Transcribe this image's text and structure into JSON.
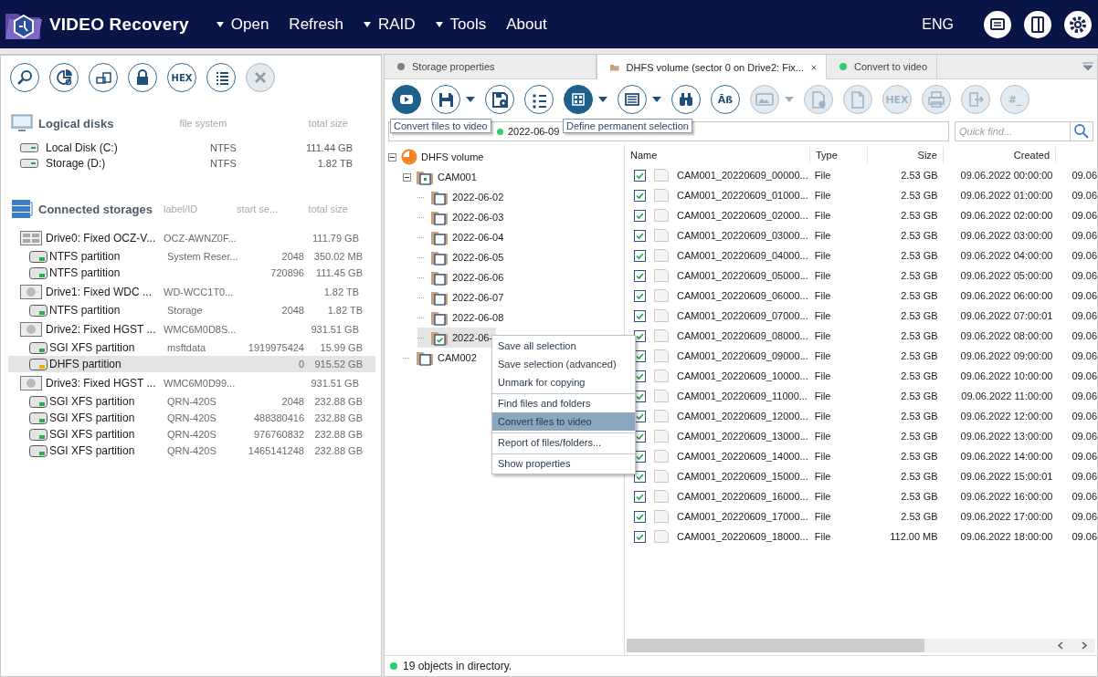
{
  "app": {
    "title": "VIDEO Recovery",
    "menu": [
      {
        "label": "Open",
        "dropdown": true
      },
      {
        "label": "Refresh",
        "dropdown": false
      },
      {
        "label": "RAID",
        "dropdown": true
      },
      {
        "label": "Tools",
        "dropdown": true
      },
      {
        "label": "About",
        "dropdown": false
      }
    ],
    "language": "ENG"
  },
  "left_toolbar": [
    {
      "disabled": false
    },
    {
      "disabled": false
    },
    {
      "disabled": false
    },
    {
      "disabled": false
    },
    {
      "label": "HEX",
      "disabled": false
    },
    {
      "disabled": false
    },
    {
      "disabled": true
    }
  ],
  "logical_disks": {
    "title": "Logical disks",
    "columns": [
      "file system",
      "total size"
    ],
    "rows": [
      {
        "name": "Local Disk (C:)",
        "file_system": "NTFS",
        "total_size": "111.44 GB"
      },
      {
        "name": "Storage (D:)",
        "file_system": "NTFS",
        "total_size": "1.82 TB"
      }
    ]
  },
  "connected_storages": {
    "title": "Connected storages",
    "columns": [
      "label/ID",
      "start se...",
      "total size"
    ],
    "drives": [
      {
        "kind": "ssd",
        "name": "Drive0: Fixed OCZ-V...",
        "label": "OCZ-AWNZ0F...",
        "total_size": "111.79 GB",
        "partitions": [
          {
            "name": "NTFS partition",
            "label": "System Reser...",
            "start": "2048",
            "total_size": "350.02 MB",
            "color": "#22b14c",
            "selected": false
          },
          {
            "name": "NTFS partition",
            "start": "720896",
            "total_size": "111.45 GB",
            "color": "#22b14c",
            "selected": false
          }
        ]
      },
      {
        "kind": "hdd",
        "name": "Drive1: Fixed WDC ...",
        "label": "WD-WCC1T0...",
        "total_size": "1.82 TB",
        "partitions": [
          {
            "name": "NTFS partition",
            "label": "Storage",
            "start": "2048",
            "total_size": "1.82 TB",
            "color": "#22b14c",
            "selected": false
          }
        ]
      },
      {
        "kind": "hdd",
        "name": "Drive2: Fixed HGST ...",
        "label": "WMC6M0D8S...",
        "total_size": "931.51 GB",
        "partitions": [
          {
            "name": "SGI XFS partition",
            "label": "msftdata",
            "start": "1919975424",
            "total_size": "15.99 GB",
            "color": "#22b14c",
            "selected": false
          },
          {
            "name": "DHFS partition",
            "start": "0",
            "total_size": "915.52 GB",
            "color": "#e8b400",
            "selected": true
          }
        ]
      },
      {
        "kind": "hdd",
        "name": "Drive3: Fixed HGST ...",
        "label": "WMC6M0D99...",
        "total_size": "931.51 GB",
        "partitions": [
          {
            "name": "SGI XFS partition",
            "label": "QRN-420S",
            "start": "2048",
            "total_size": "232.88 GB",
            "color": "#22b14c",
            "selected": false
          },
          {
            "name": "SGI XFS partition",
            "label": "QRN-420S",
            "start": "488380416",
            "total_size": "232.88 GB",
            "color": "#22b14c",
            "selected": false
          },
          {
            "name": "SGI XFS partition",
            "label": "QRN-420S",
            "start": "976760832",
            "total_size": "232.88 GB",
            "color": "#22b14c",
            "selected": false
          },
          {
            "name": "SGI XFS partition",
            "label": "QRN-420S",
            "start": "1465141248",
            "total_size": "232.88 GB",
            "color": "#22b14c",
            "selected": false
          }
        ]
      }
    ]
  },
  "tabs": [
    {
      "kind": "dot",
      "label": "Storage properties",
      "color": "#808080",
      "selected": false,
      "closable": false
    },
    {
      "kind": "folder",
      "label": "DHFS volume (sector 0 on Drive2: Fix...",
      "selected": true,
      "closable": true
    },
    {
      "kind": "dot",
      "label": "Convert to video",
      "color": "#2ecc71",
      "selected": false,
      "closable": false
    }
  ],
  "toolbar": [
    {
      "active": true,
      "dropdown": false,
      "disabled": false,
      "tooltip": "Convert files to video"
    },
    {
      "active": false,
      "dropdown": true,
      "disabled": false
    },
    {
      "active": false,
      "dropdown": false,
      "disabled": false
    },
    {
      "active": false,
      "dropdown": false,
      "disabled": false
    },
    {
      "active": true,
      "dropdown": true,
      "disabled": false,
      "tooltip": "Define permanent selection"
    },
    {
      "active": false,
      "dropdown": true,
      "disabled": false
    },
    {
      "active": false,
      "dropdown": false,
      "disabled": false
    },
    {
      "active": false,
      "dropdown": false,
      "disabled": false,
      "label": "Āß"
    },
    {
      "active": false,
      "dropdown": true,
      "disabled": true
    },
    {
      "active": false,
      "dropdown": false,
      "disabled": true
    },
    {
      "active": false,
      "dropdown": false,
      "disabled": true
    },
    {
      "active": false,
      "dropdown": false,
      "disabled": true,
      "label": "HEX"
    },
    {
      "active": false,
      "dropdown": false,
      "disabled": true
    },
    {
      "active": false,
      "dropdown": false,
      "disabled": true
    },
    {
      "active": false,
      "dropdown": false,
      "disabled": true,
      "label": "#_"
    }
  ],
  "breadcrumb": {
    "label": "2022-06-09",
    "color": "#2ecc71"
  },
  "quick_find": {
    "placeholder": "Quick find..."
  },
  "tree": {
    "label": "DHFS volume",
    "expanded": true,
    "selected": false,
    "children": [
      {
        "label": "CAM001",
        "expanded": true,
        "checked": false,
        "mixed": true,
        "selected": false,
        "children": [
          {
            "label": "2022-06-02",
            "checked": false,
            "mixed": false,
            "selected": false
          },
          {
            "label": "2022-06-03",
            "checked": false,
            "mixed": false,
            "selected": false
          },
          {
            "label": "2022-06-04",
            "checked": false,
            "mixed": false,
            "selected": false
          },
          {
            "label": "2022-06-05",
            "checked": false,
            "mixed": false,
            "selected": false
          },
          {
            "label": "2022-06-06",
            "checked": false,
            "mixed": false,
            "selected": false
          },
          {
            "label": "2022-06-07",
            "checked": false,
            "mixed": false,
            "selected": false
          },
          {
            "label": "2022-06-08",
            "checked": false,
            "mixed": false,
            "selected": false
          },
          {
            "label": "2022-06-",
            "checked": true,
            "mixed": false,
            "selected": true
          }
        ]
      },
      {
        "label": "CAM002",
        "checked": false,
        "mixed": false,
        "selected": false
      }
    ]
  },
  "table": {
    "columns": [
      "Name",
      "Type",
      "Size",
      "Created"
    ],
    "rows": [
      {
        "checked": true,
        "name": "CAM001_20220609_00000...",
        "type": "File",
        "size": "2.53 GB",
        "created": "09.06.2022 00:00:00",
        "column_5": "09.06"
      },
      {
        "checked": true,
        "name": "CAM001_20220609_01000...",
        "type": "File",
        "size": "2.53 GB",
        "created": "09.06.2022 01:00:00",
        "column_5": "09.06"
      },
      {
        "checked": true,
        "name": "CAM001_20220609_02000...",
        "type": "File",
        "size": "2.53 GB",
        "created": "09.06.2022 02:00:00",
        "column_5": "09.06"
      },
      {
        "checked": true,
        "name": "CAM001_20220609_03000...",
        "type": "File",
        "size": "2.53 GB",
        "created": "09.06.2022 03:00:00",
        "column_5": "09.06"
      },
      {
        "checked": true,
        "name": "CAM001_20220609_04000...",
        "type": "File",
        "size": "2.53 GB",
        "created": "09.06.2022 04:00:00",
        "column_5": "09.06"
      },
      {
        "checked": true,
        "name": "CAM001_20220609_05000...",
        "type": "File",
        "size": "2.53 GB",
        "created": "09.06.2022 05:00:00",
        "column_5": "09.06"
      },
      {
        "checked": true,
        "name": "CAM001_20220609_06000...",
        "type": "File",
        "size": "2.53 GB",
        "created": "09.06.2022 06:00:00",
        "column_5": "09.06"
      },
      {
        "checked": true,
        "name": "CAM001_20220609_07000...",
        "type": "File",
        "size": "2.53 GB",
        "created": "09.06.2022 07:00:01",
        "column_5": "09.06"
      },
      {
        "checked": true,
        "name": "CAM001_20220609_08000...",
        "type": "File",
        "size": "2.53 GB",
        "created": "09.06.2022 08:00:00",
        "column_5": "09.06"
      },
      {
        "checked": true,
        "name": "CAM001_20220609_09000...",
        "type": "File",
        "size": "2.53 GB",
        "created": "09.06.2022 09:00:00",
        "column_5": "09.06"
      },
      {
        "checked": true,
        "name": "CAM001_20220609_10000...",
        "type": "File",
        "size": "2.53 GB",
        "created": "09.06.2022 10:00:00",
        "column_5": "09.06"
      },
      {
        "checked": true,
        "name": "CAM001_20220609_11000...",
        "type": "File",
        "size": "2.53 GB",
        "created": "09.06.2022 11:00:00",
        "column_5": "09.06"
      },
      {
        "checked": true,
        "name": "CAM001_20220609_12000...",
        "type": "File",
        "size": "2.53 GB",
        "created": "09.06.2022 12:00:00",
        "column_5": "09.06"
      },
      {
        "checked": true,
        "name": "CAM001_20220609_13000...",
        "type": "File",
        "size": "2.53 GB",
        "created": "09.06.2022 13:00:00",
        "column_5": "09.06"
      },
      {
        "checked": true,
        "name": "CAM001_20220609_14000...",
        "type": "File",
        "size": "2.53 GB",
        "created": "09.06.2022 14:00:00",
        "column_5": "09.06"
      },
      {
        "checked": true,
        "name": "CAM001_20220609_15000...",
        "type": "File",
        "size": "2.53 GB",
        "created": "09.06.2022 15:00:01",
        "column_5": "09.06"
      },
      {
        "checked": true,
        "name": "CAM001_20220609_16000...",
        "type": "File",
        "size": "2.53 GB",
        "created": "09.06.2022 16:00:00",
        "column_5": "09.06"
      },
      {
        "checked": true,
        "name": "CAM001_20220609_17000...",
        "type": "File",
        "size": "2.53 GB",
        "created": "09.06.2022 17:00:00",
        "column_5": "09.06"
      },
      {
        "checked": true,
        "name": "CAM001_20220609_18000...",
        "type": "File",
        "size": "112.00 MB",
        "created": "09.06.2022 18:00:00",
        "column_5": "09.06"
      }
    ]
  },
  "context_menu": {
    "items": [
      {
        "label": "Save all selection",
        "selected": false,
        "separator_before": false
      },
      {
        "label": "Save selection (advanced)",
        "selected": false,
        "separator_before": false
      },
      {
        "label": "Unmark for copying",
        "selected": false,
        "separator_before": false
      },
      {
        "label": "Find files and folders",
        "selected": false,
        "separator_before": true
      },
      {
        "label": "Convert files to video",
        "selected": true,
        "separator_before": false
      },
      {
        "label": "Report of files/folders...",
        "selected": false,
        "separator_before": true
      },
      {
        "label": "Show properties",
        "selected": false,
        "separator_before": true
      }
    ]
  },
  "status_bar": {
    "text": "19 objects in directory.",
    "color": "#2ecc71"
  }
}
